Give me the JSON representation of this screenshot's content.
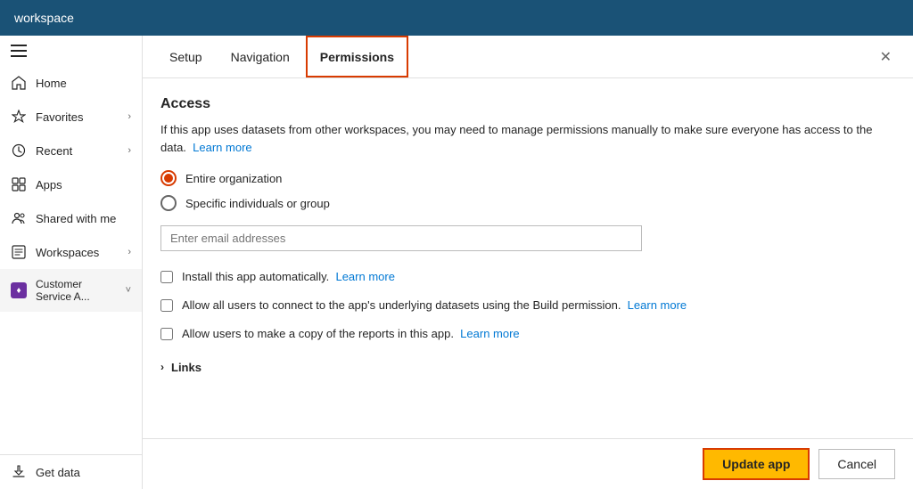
{
  "topbar": {
    "title": "workspace"
  },
  "sidebar": {
    "hamburger_label": "menu",
    "items": [
      {
        "id": "home",
        "label": "Home",
        "icon": "home-icon",
        "hasChevron": false
      },
      {
        "id": "favorites",
        "label": "Favorites",
        "icon": "favorites-icon",
        "hasChevron": true
      },
      {
        "id": "recent",
        "label": "Recent",
        "icon": "recent-icon",
        "hasChevron": true
      },
      {
        "id": "apps",
        "label": "Apps",
        "icon": "apps-icon",
        "hasChevron": false
      },
      {
        "id": "shared",
        "label": "Shared with me",
        "icon": "shared-icon",
        "hasChevron": false
      },
      {
        "id": "workspaces",
        "label": "Workspaces",
        "icon": "workspaces-icon",
        "hasChevron": true
      },
      {
        "id": "customer",
        "label": "Customer Service A...",
        "icon": "customer-icon",
        "hasChevron": true,
        "active": true
      }
    ],
    "bottom": {
      "label": "Get data",
      "icon": "get-data-icon"
    }
  },
  "tabs": {
    "items": [
      {
        "id": "setup",
        "label": "Setup",
        "active": false
      },
      {
        "id": "navigation",
        "label": "Navigation",
        "active": false
      },
      {
        "id": "permissions",
        "label": "Permissions",
        "active": true
      }
    ]
  },
  "permissions": {
    "access_title": "Access",
    "access_desc": "If this app uses datasets from other workspaces, you may need to manage permissions manually to make sure everyone has access to the data.",
    "learn_more_1": "Learn more",
    "radio_options": [
      {
        "id": "entire_org",
        "label": "Entire organization",
        "selected": true
      },
      {
        "id": "specific",
        "label": "Specific individuals or group",
        "selected": false
      }
    ],
    "email_placeholder": "Enter email addresses",
    "checkboxes": [
      {
        "id": "install_auto",
        "label": "Install this app automatically.",
        "learn_more": "Learn more",
        "checked": false
      },
      {
        "id": "allow_build",
        "label": "Allow all users to connect to the app's underlying datasets using the Build permission.",
        "learn_more": "Learn more",
        "checked": false
      },
      {
        "id": "allow_copy",
        "label": "Allow users to make a copy of the reports in this app.",
        "learn_more": "Learn more",
        "checked": false
      }
    ],
    "links_label": "Links"
  },
  "footer": {
    "update_label": "Update app",
    "cancel_label": "Cancel"
  }
}
